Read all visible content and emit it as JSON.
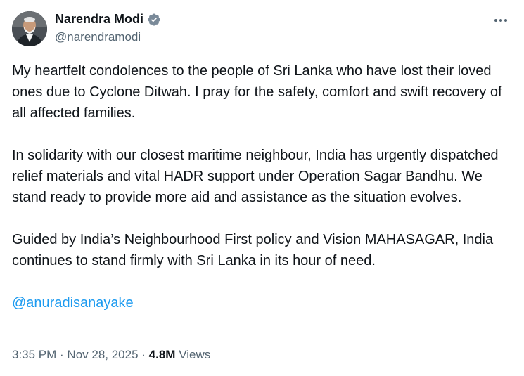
{
  "author": {
    "name": "Narendra Modi",
    "handle": "@narendramodi",
    "verified": true,
    "avatar_icon": "profile-photo"
  },
  "more_icon": "ellipsis-icon",
  "tweet": {
    "paragraphs": [
      "My heartfelt condolences to the people of Sri Lanka who have lost their loved ones due to Cyclone Ditwah. I pray for the safety, comfort and swift recovery of all affected families.",
      "In solidarity with our closest maritime neighbour, India has urgently dispatched relief materials and vital HADR support under Operation Sagar Bandhu. We stand ready to provide more aid and assistance as the situation evolves.",
      "Guided by India’s Neighbourhood First policy and Vision MAHASAGAR, India continues to stand firmly with Sri Lanka in its hour of need."
    ],
    "mention": "@anuradisanayake"
  },
  "meta": {
    "time": "3:35 PM",
    "separator": " · ",
    "date": "Nov 28, 2025",
    "views_count": "4.8M",
    "views_label": " Views"
  },
  "colors": {
    "link": "#1d9bf0",
    "secondary_text": "#536471",
    "primary_text": "#0f1419",
    "verified_badge": "#7a8a99"
  }
}
